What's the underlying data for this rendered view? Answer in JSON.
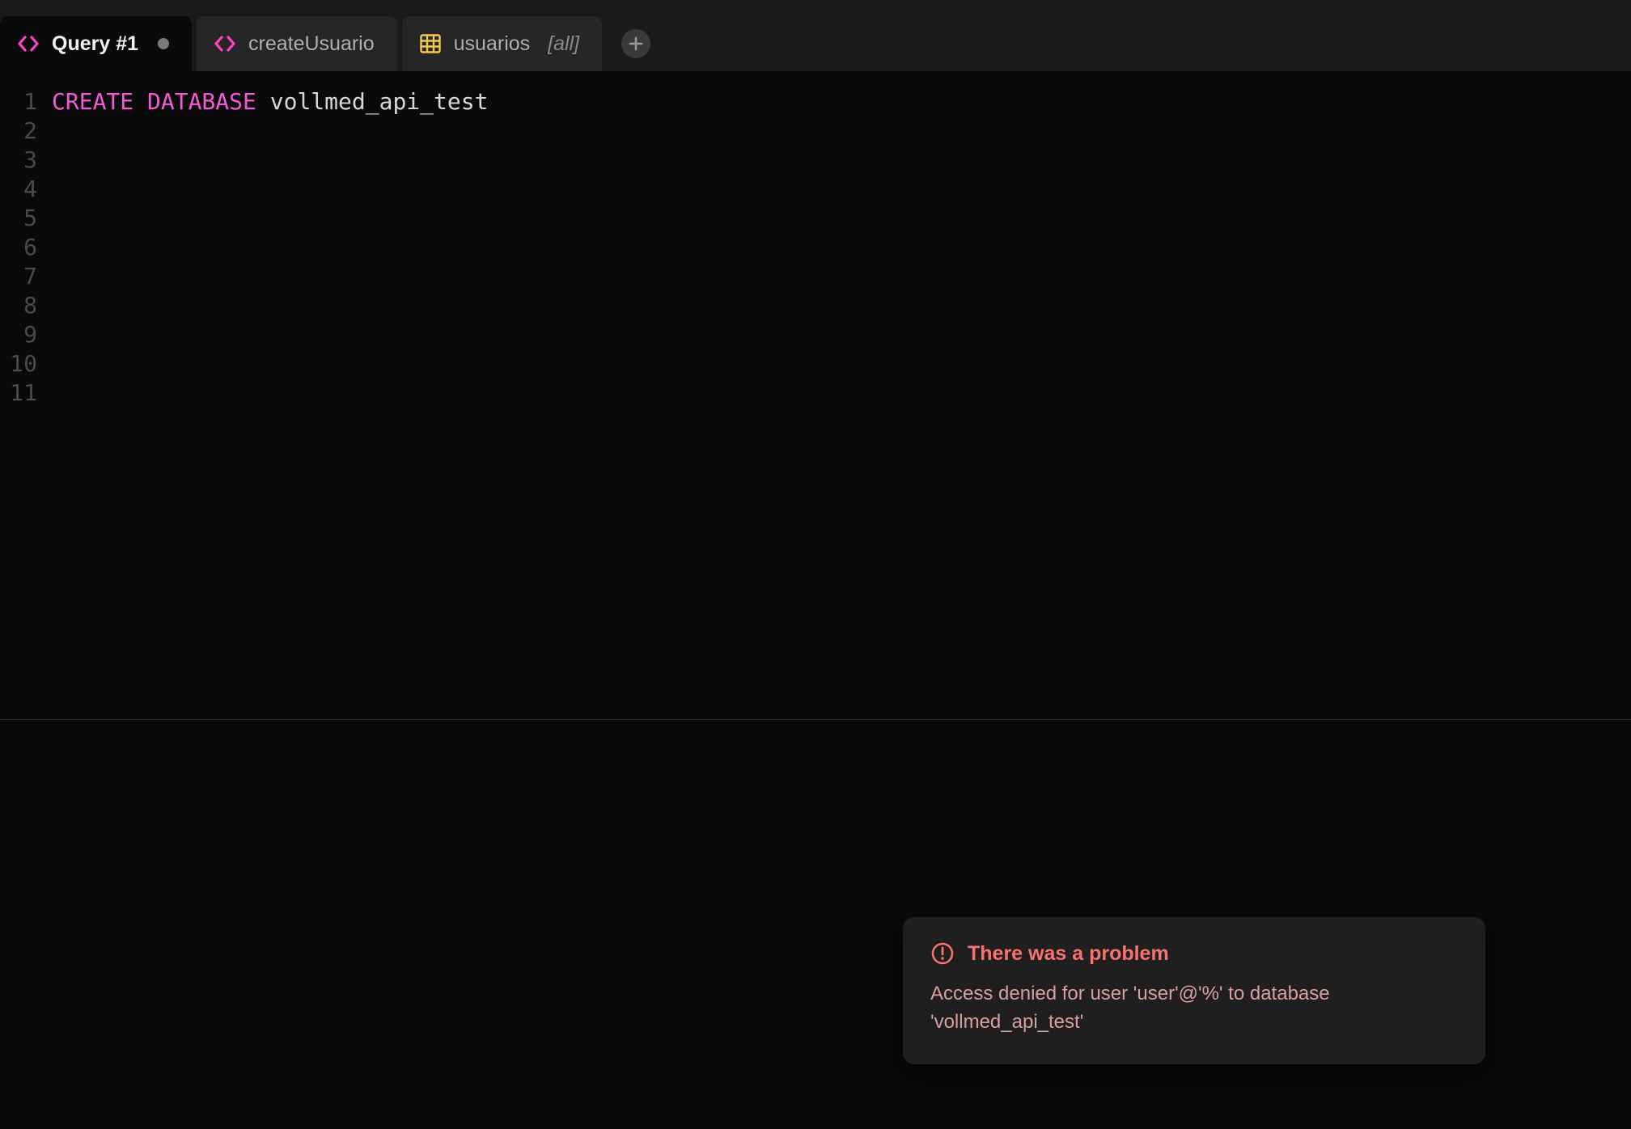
{
  "tabs": [
    {
      "label": "Query #1",
      "type": "code",
      "active": true,
      "dirty": true
    },
    {
      "label": "createUsuario",
      "type": "code",
      "active": false,
      "dirty": false
    },
    {
      "label": "usuarios",
      "suffix": "[all]",
      "type": "table",
      "active": false,
      "dirty": false
    }
  ],
  "editor": {
    "line_count": 11,
    "sql_keywords": "CREATE DATABASE",
    "sql_identifier": "vollmed_api_test"
  },
  "toast": {
    "title": "There was a problem",
    "message": "Access denied for user 'user'@'%' to database 'vollmed_api_test'"
  },
  "colors": {
    "keyword": "#f25ad6",
    "error": "#f87171",
    "table_icon": "#f2c94c"
  }
}
